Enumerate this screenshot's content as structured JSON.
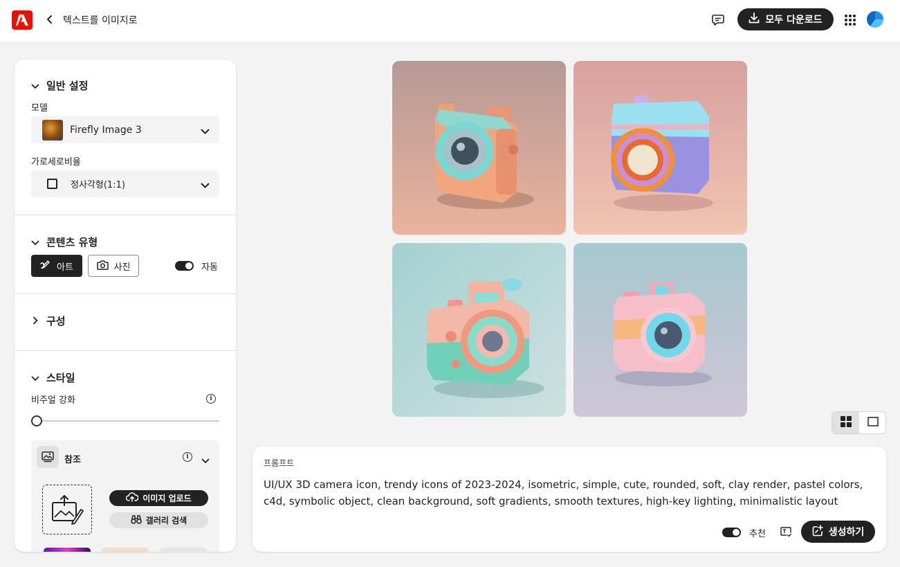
{
  "header": {
    "title": "텍스트를 이미지로",
    "download_all_label": "모두 다운로드",
    "icons": [
      "adobe-logo",
      "back-chevron-icon",
      "feedback-icon",
      "download-icon",
      "apps-grid-icon",
      "avatar"
    ]
  },
  "panel": {
    "general": {
      "title": "일반 설정",
      "model_label": "모델",
      "model_value": "Firefly Image 3",
      "aspect_label": "가로세로비율",
      "aspect_value": "정사각형(1:1)"
    },
    "content_type": {
      "title": "콘텐츠 유형",
      "art_label": "아트",
      "photo_label": "사진",
      "auto_label": "자동",
      "auto_on": true,
      "selected": "아트"
    },
    "composition": {
      "title": "구성"
    },
    "style": {
      "title": "스타일",
      "visual_intensity_label": "비주얼 강화",
      "visual_intensity_value": 0,
      "reference": {
        "title": "참조",
        "upload_label": "이미지 업로드",
        "gallery_label": "갤러리 검색"
      }
    }
  },
  "images": [
    {
      "alt": "camera-1",
      "bg": [
        "#b89a98",
        "#e8b4a0"
      ]
    },
    {
      "alt": "camera-2",
      "bg": [
        "#d9a0a0",
        "#f0c8b8"
      ]
    },
    {
      "alt": "camera-3",
      "bg": [
        "#a8d0d0",
        "#c8e0e0"
      ]
    },
    {
      "alt": "camera-4",
      "bg": [
        "#a8c8d0",
        "#d0c8d8"
      ]
    }
  ],
  "view_toggle": {
    "selected": "grid"
  },
  "prompt": {
    "label": "프롬프트",
    "text": "UI/UX 3D camera icon, trendy icons of 2023-2024, isometric, simple, cute, rounded, soft, clay render, pastel colors, c4d, symbolic object, clean background, soft gradients, smooth textures, high-key lighting, minimalistic layout",
    "recommend_label": "추천",
    "recommend_on": true,
    "generate_label": "생성하기"
  },
  "colors": {
    "accent": "#222222",
    "brand": "#eb1000"
  }
}
